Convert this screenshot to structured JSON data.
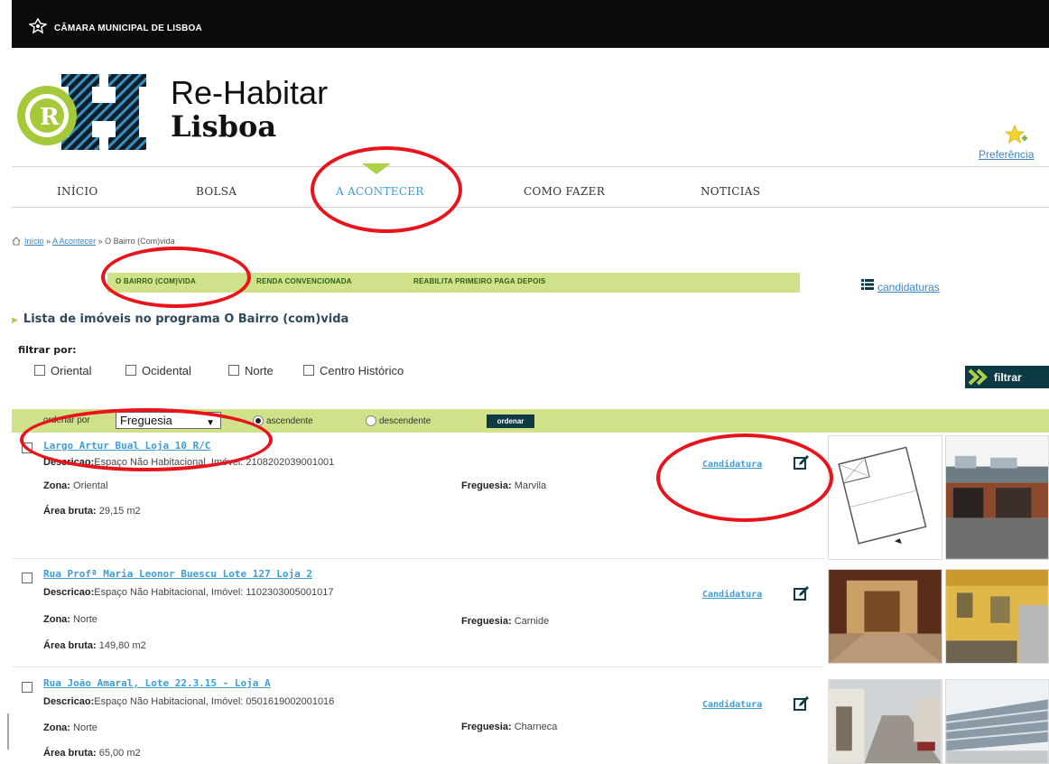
{
  "header": {
    "title": "CÂMARA MUNICIPAL DE LISBOA"
  },
  "brand": {
    "line1": "Re-Habitar",
    "line2": "Lisboa",
    "preferences": "Preferência"
  },
  "nav": {
    "items": [
      {
        "label": "INÍCIO"
      },
      {
        "label": "BOLSA"
      },
      {
        "label": "A ACONTECER"
      },
      {
        "label": "COMO FAZER"
      },
      {
        "label": "NOTICIAS"
      }
    ],
    "active": "A ACONTECER"
  },
  "breadcrumb": {
    "home": "Início",
    "sep1": " » ",
    "section": "A Acontecer",
    "sep2": " » ",
    "current": "O Bairro (Com)vida"
  },
  "subtabs": {
    "items": [
      {
        "label": "O BAIRRO (COM)VIDA"
      },
      {
        "label": "RENDA CONVENCIONADA"
      },
      {
        "label": "REABILITA PRIMEIRO PAGA DEPOIS"
      }
    ],
    "candidaturas": "candidaturas"
  },
  "list_title": "Lista de imóveis no programa O Bairro (com)vida",
  "filter": {
    "label": "filtrar por:",
    "options": [
      {
        "label": "Oriental",
        "checked": false
      },
      {
        "label": "Ocidental",
        "checked": false
      },
      {
        "label": "Norte",
        "checked": false
      },
      {
        "label": "Centro Histórico",
        "checked": false
      }
    ],
    "button": "filtrar"
  },
  "sort": {
    "label": "ordenar por",
    "selected": "Freguesia",
    "asc": "ascendente",
    "desc": "descendente",
    "direction": "ascendente",
    "button": "ordenar"
  },
  "listings": [
    {
      "title": "Largo Artur Bual Loja 10 R/C",
      "desc_label": "Descricao:",
      "desc": "Espaço Não Habitacional, Imóvel: 2108202039001001",
      "zona_label": "Zona:",
      "zona": "Oriental",
      "freguesia_label": "Freguesia:",
      "freguesia": "Marvila",
      "area_label": "Área bruta:",
      "area": "29,15 m2",
      "action": "Candidatura"
    },
    {
      "title": "Rua Profª Maria Leonor Buescu Lote 127 Loja 2",
      "desc_label": "Descricao:",
      "desc": "Espaço Não Habitacional, Imóvel: 1102303005001017",
      "zona_label": "Zona:",
      "zona": "Norte",
      "freguesia_label": "Freguesia:",
      "freguesia": "Carnide",
      "area_label": "Área bruta:",
      "area": "149,80 m2",
      "action": "Candidatura"
    },
    {
      "title": "Rua João Amaral, Lote 22.3.15 - Loja A",
      "desc_label": "Descricao:",
      "desc": "Espaço Não Habitacional, Imóvel: 0501619002001016",
      "zona_label": "Zona:",
      "zona": "Norte",
      "freguesia_label": "Freguesia:",
      "freguesia": "Charneca",
      "area_label": "Área bruta:",
      "area": "65,00 m2",
      "action": "Candidatura"
    }
  ],
  "colors": {
    "accent_green": "#cfe28a",
    "link_blue": "#3c9ed8",
    "dark_button": "#0e3a45",
    "annotation_red": "#e8131b"
  }
}
